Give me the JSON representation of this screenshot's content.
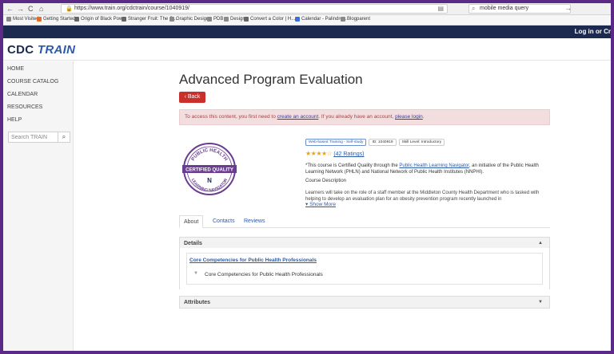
{
  "browser": {
    "url": "https://www.train.org/cdctrain/course/1040919/",
    "search_value": "mobile media query",
    "nav_back": "←",
    "nav_forward": "→",
    "nav_reload": "C",
    "nav_home": "⌂",
    "menu_dots": "•••",
    "bookmarks": [
      {
        "label": "Most Visited",
        "color": "#888"
      },
      {
        "label": "Getting Started",
        "color": "#e66b24"
      },
      {
        "label": "Origin of Black Pow...",
        "color": "#666"
      },
      {
        "label": "Stranger Fruit: The C...",
        "color": "#666"
      },
      {
        "label": "Graphic Design",
        "color": "#8a8a8a"
      },
      {
        "label": "PDB",
        "color": "#8a8a8a"
      },
      {
        "label": "Design",
        "color": "#8a8a8a"
      },
      {
        "label": "Convert a Color | H...",
        "color": "#666"
      },
      {
        "label": "Calendar - Palindro...",
        "color": "#3b6fd6"
      },
      {
        "label": "Blogparent",
        "color": "#8a8a8a"
      }
    ]
  },
  "header": {
    "login": "Log in or Cr",
    "brand_cdc": "CDC",
    "brand_train": "TRAIN"
  },
  "sidebar": {
    "items": [
      {
        "label": "HOME"
      },
      {
        "label": "COURSE CATALOG"
      },
      {
        "label": "CALENDAR"
      },
      {
        "label": "RESOURCES"
      },
      {
        "label": "HELP"
      }
    ],
    "search_placeholder": "Search TRAIN"
  },
  "course": {
    "title": "Advanced Program Evaluation",
    "back_label": "Back",
    "alert": {
      "prefix": "To access this content, you first need to ",
      "create_link": "create an account",
      "middle": ". If you already have an account, please ",
      "login_link": "please login",
      "suffix": "."
    },
    "badge": {
      "top": "PUBLIC HEALTH",
      "ribbon": "CERTIFIED QUALITY",
      "bottom": "LEARNING NAVIGATOR"
    },
    "tags": [
      "Web-based Training - Self-study",
      "ID: 1040919",
      "Skill Level: Introductory"
    ],
    "rating_stars": "★★★★☆",
    "rating_value": 4,
    "rating_count": "(42 Ratings)",
    "desc_prefix": "*This course is Certified Quality through the ",
    "desc_link": "Public Health Learning Navigator",
    "desc_suffix": ", an initiative of the Public Health Learning Network (PHLN) and National Network of Public Health Institutes (NNPHI).",
    "course_desc_label": "Course Description",
    "course_desc_text": "Learners will take on the role of a staff member at the Middleton County Health Department who is tasked with helping to develop an evaluation plan for an obesity prevention program recently launched in",
    "show_more": "▾ Show More"
  },
  "tabs": [
    {
      "label": "About"
    },
    {
      "label": "Contacts"
    },
    {
      "label": "Reviews"
    }
  ],
  "details": {
    "title": "Details",
    "caret": "▲",
    "competency_link": "Core Competencies for Public Health Professionals",
    "competency_item": "Core Competencies for Public Health Professionals"
  },
  "attributes": {
    "title": "Attributes",
    "caret": "▼"
  },
  "colors": {
    "frame": "#5b2a86",
    "navy": "#1b2a4e",
    "back_button": "#c9302c",
    "alert_bg": "#f2dede",
    "link": "#2d5aa8",
    "badge_purple": "#6a3d91",
    "stars": "#e8a317"
  }
}
